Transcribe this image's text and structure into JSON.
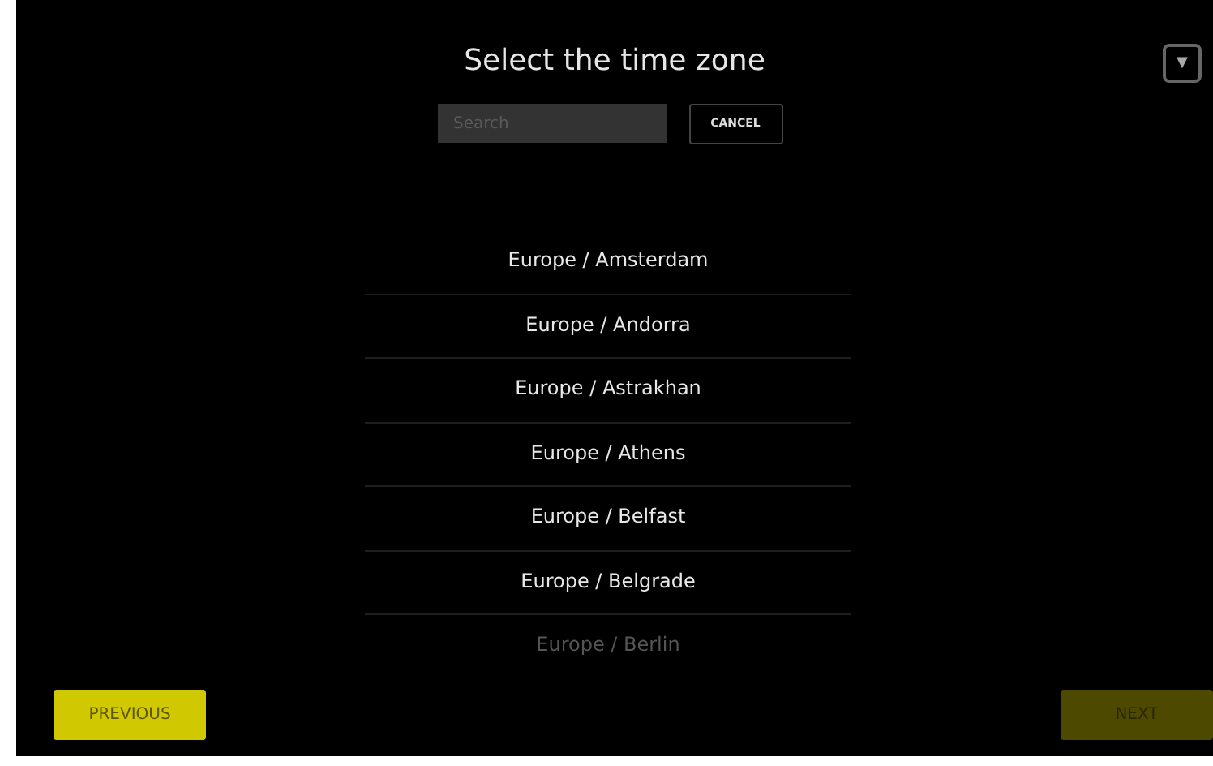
{
  "title": "Select the time zone",
  "menu_button": {
    "label": "▼"
  },
  "search": {
    "placeholder": "Search"
  },
  "cancel_button": {
    "label": "CANCEL"
  },
  "time_zones": [
    {
      "label": "Europe / Amsterdam",
      "faded": false
    },
    {
      "label": "Europe / Andorra",
      "faded": false
    },
    {
      "label": "Europe / Astrakhan",
      "faded": false
    },
    {
      "label": "Europe / Athens",
      "faded": false
    },
    {
      "label": "Europe / Belfast",
      "faded": false
    },
    {
      "label": "Europe / Belgrade",
      "faded": false
    },
    {
      "label": "Europe / Berlin",
      "faded": true
    }
  ],
  "previous_button": {
    "label": "PREVIOUS",
    "disabled": false
  },
  "next_button": {
    "label": "NEXT",
    "disabled": true
  }
}
